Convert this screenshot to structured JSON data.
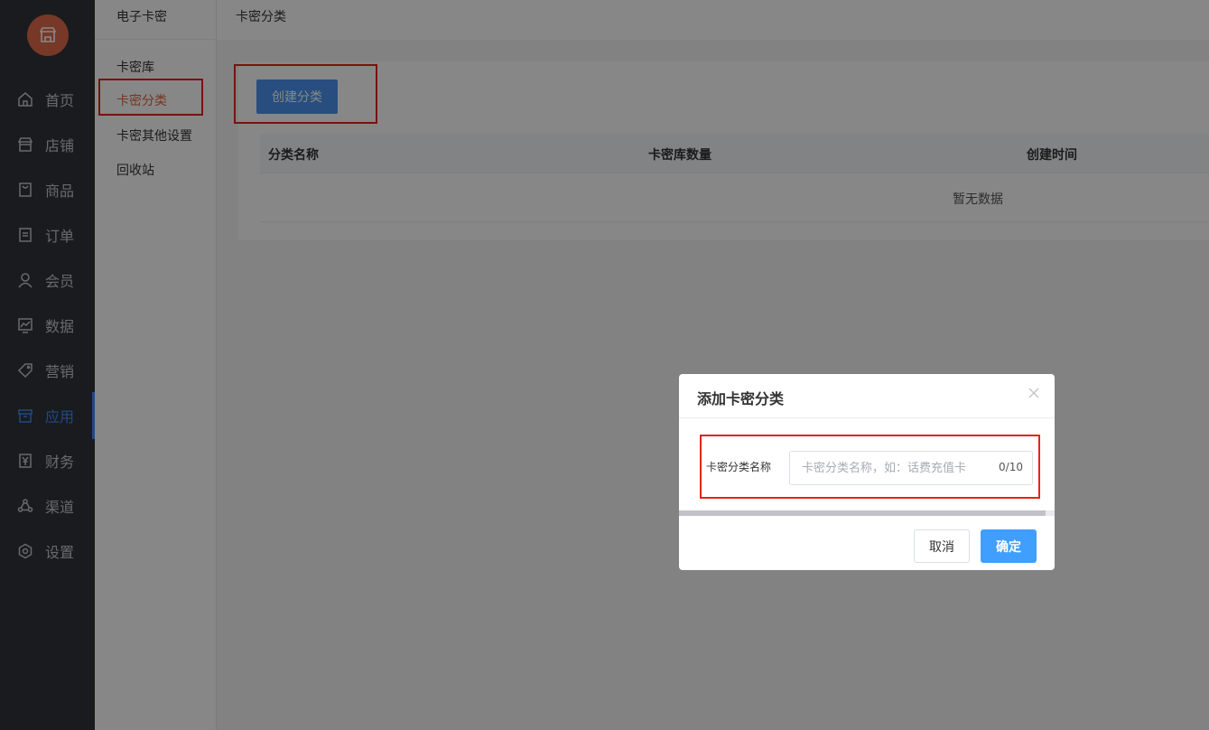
{
  "primary_nav": {
    "items": [
      {
        "label": "首页",
        "icon": "home-icon"
      },
      {
        "label": "店铺",
        "icon": "store-icon"
      },
      {
        "label": "商品",
        "icon": "goods-icon"
      },
      {
        "label": "订单",
        "icon": "order-icon"
      },
      {
        "label": "会员",
        "icon": "member-icon"
      },
      {
        "label": "数据",
        "icon": "chart-icon"
      },
      {
        "label": "营销",
        "icon": "tag-icon"
      },
      {
        "label": "应用",
        "icon": "app-box-icon"
      },
      {
        "label": "财务",
        "icon": "finance-icon"
      },
      {
        "label": "渠道",
        "icon": "channel-icon"
      },
      {
        "label": "设置",
        "icon": "settings-icon"
      }
    ],
    "active_index": 7
  },
  "secondary_nav": {
    "title": "电子卡密",
    "items": [
      {
        "label": "卡密库"
      },
      {
        "label": "卡密分类"
      },
      {
        "label": "卡密其他设置"
      },
      {
        "label": "回收站"
      }
    ],
    "active_index": 1
  },
  "main": {
    "page_title": "卡密分类",
    "create_button_label": "创建分类",
    "table": {
      "columns": [
        "分类名称",
        "卡密库数量",
        "创建时间"
      ],
      "empty_text": "暂无数据"
    }
  },
  "dialog": {
    "title": "添加卡密分类",
    "field_label": "卡密分类名称",
    "input_placeholder": "卡密分类名称，如：话费充值卡",
    "input_value": "",
    "char_count": "0/10",
    "cancel_label": "取消",
    "confirm_label": "确定"
  },
  "colors": {
    "accent": "#409eff",
    "active_secondary": "#e0663f",
    "highlight_box": "#e8231c",
    "sidebar_bg": "#30333a"
  }
}
